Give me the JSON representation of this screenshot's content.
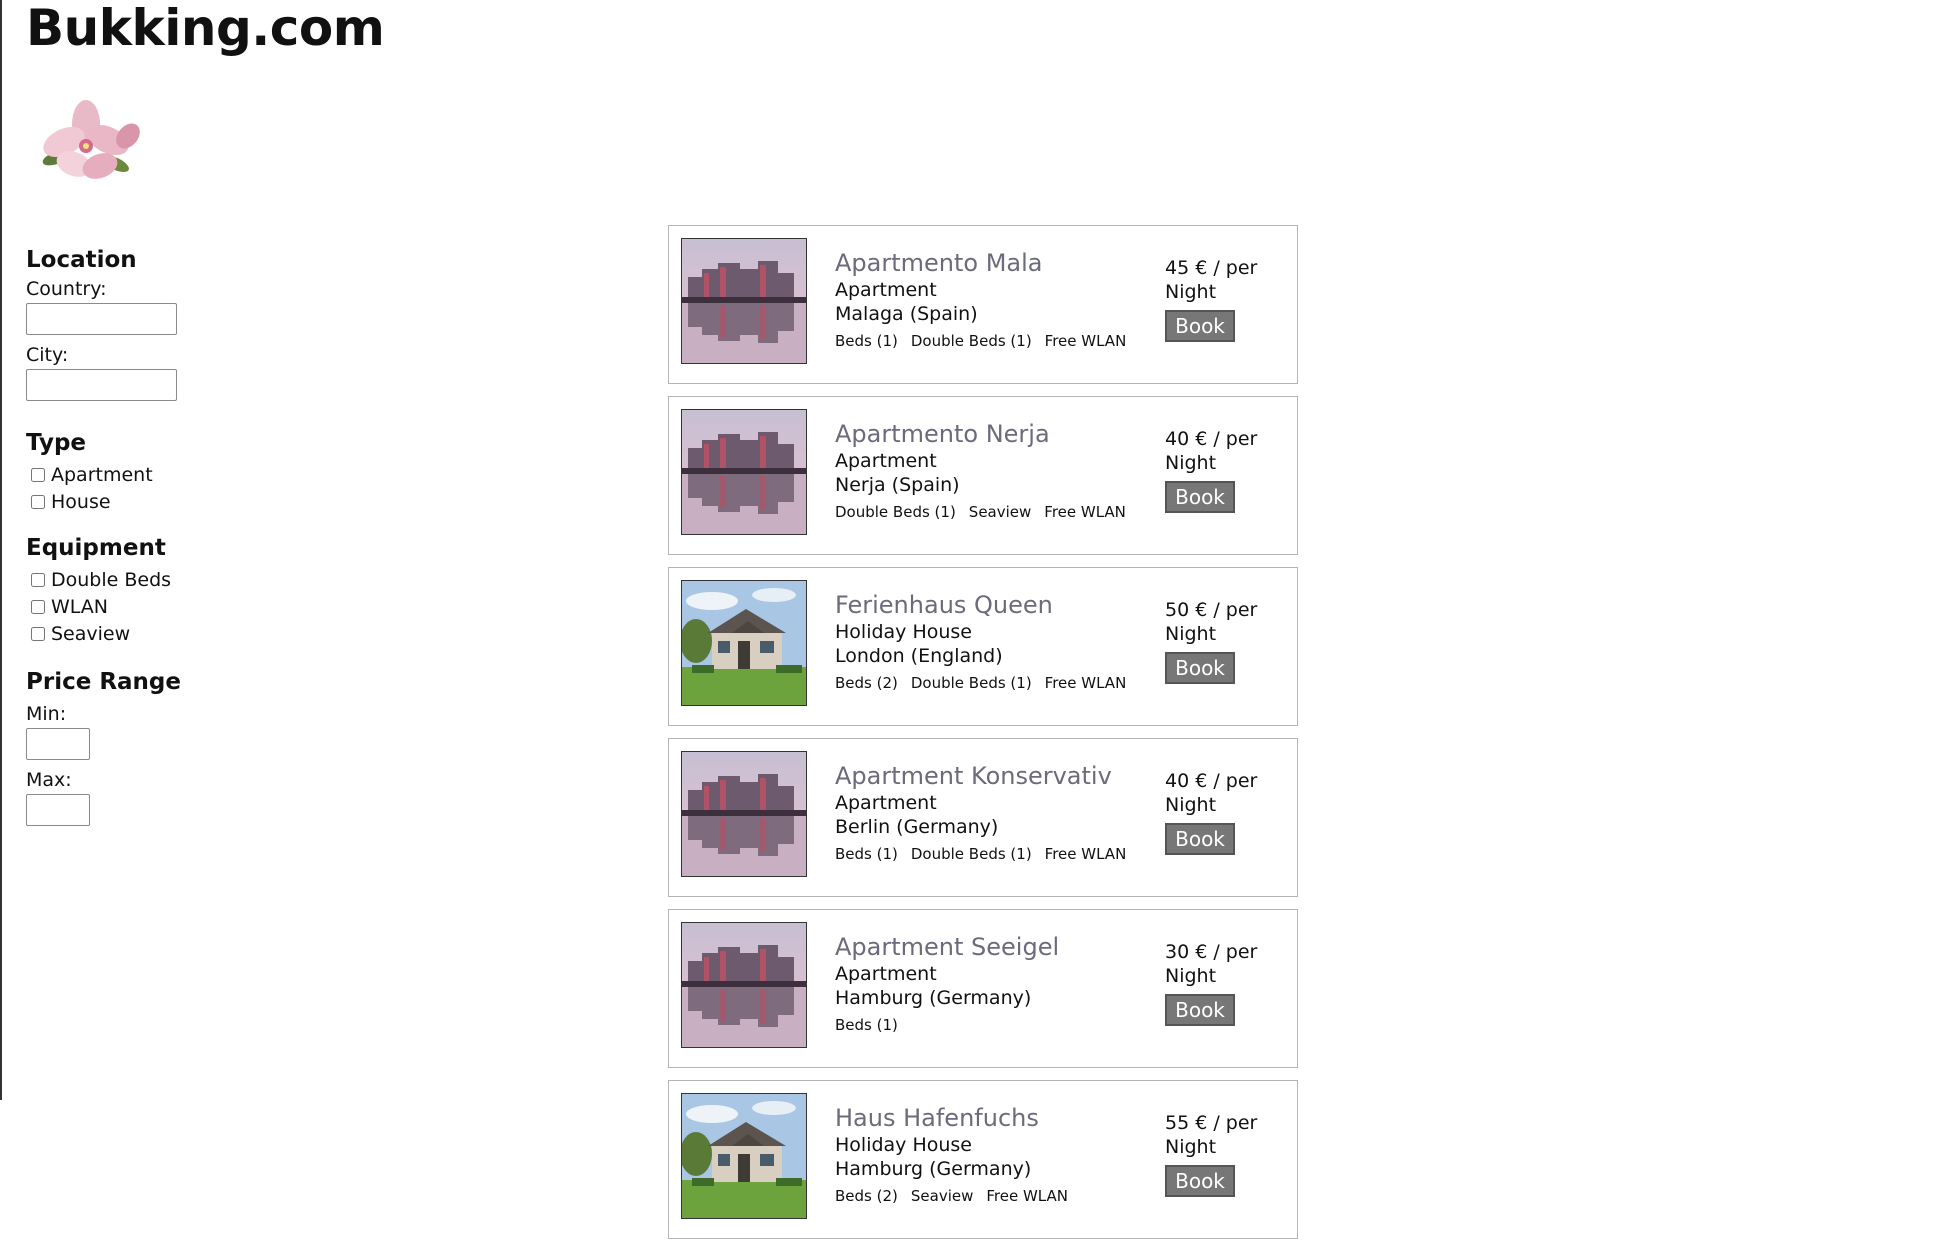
{
  "brand": "Bukking.com",
  "logo_icon": "magnolia-flower",
  "filters": {
    "location": {
      "heading": "Location",
      "country_label": "Country:",
      "city_label": "City:"
    },
    "type": {
      "heading": "Type",
      "options": [
        "Apartment",
        "House"
      ]
    },
    "equipment": {
      "heading": "Equipment",
      "options": [
        "Double Beds",
        "WLAN",
        "Seaview"
      ]
    },
    "price_range": {
      "heading": "Price Range",
      "min_label": "Min:",
      "max_label": "Max:"
    }
  },
  "listings": [
    {
      "title": "Apartmento Mala",
      "type": "Apartment",
      "location": "Malaga (Spain)",
      "features": [
        "Beds (1)",
        "Double Beds (1)",
        "Free WLAN"
      ],
      "price": "45 € / per",
      "per": "Night",
      "book_label": "Book",
      "image": "apartment-building-photo"
    },
    {
      "title": "Apartmento Nerja",
      "type": "Apartment",
      "location": "Nerja (Spain)",
      "features": [
        "Double Beds (1)",
        "Seaview",
        "Free WLAN"
      ],
      "price": "40 € / per",
      "per": "Night",
      "book_label": "Book",
      "image": "apartment-building-photo"
    },
    {
      "title": "Ferienhaus Queen",
      "type": "Holiday House",
      "location": "London (England)",
      "features": [
        "Beds (2)",
        "Double Beds (1)",
        "Free WLAN"
      ],
      "price": "50 € / per",
      "per": "Night",
      "book_label": "Book",
      "image": "house-photo"
    },
    {
      "title": "Apartment Konservativ",
      "type": "Apartment",
      "location": "Berlin (Germany)",
      "features": [
        "Beds (1)",
        "Double Beds (1)",
        "Free WLAN"
      ],
      "price": "40 € / per",
      "per": "Night",
      "book_label": "Book",
      "image": "apartment-building-photo"
    },
    {
      "title": "Apartment Seeigel",
      "type": "Apartment",
      "location": "Hamburg (Germany)",
      "features": [
        "Beds (1)"
      ],
      "price": "30 € / per",
      "per": "Night",
      "book_label": "Book",
      "image": "apartment-building-photo"
    },
    {
      "title": "Haus Hafenfuchs",
      "type": "Holiday House",
      "location": "Hamburg (Germany)",
      "features": [
        "Beds (2)",
        "Seaview",
        "Free WLAN"
      ],
      "price": "55 € / per",
      "per": "Night",
      "book_label": "Book",
      "image": "house-photo"
    }
  ],
  "colors": {
    "title_text": "#6b6b7c",
    "book_button": "#777777",
    "card_border": "#b5b5b5"
  }
}
